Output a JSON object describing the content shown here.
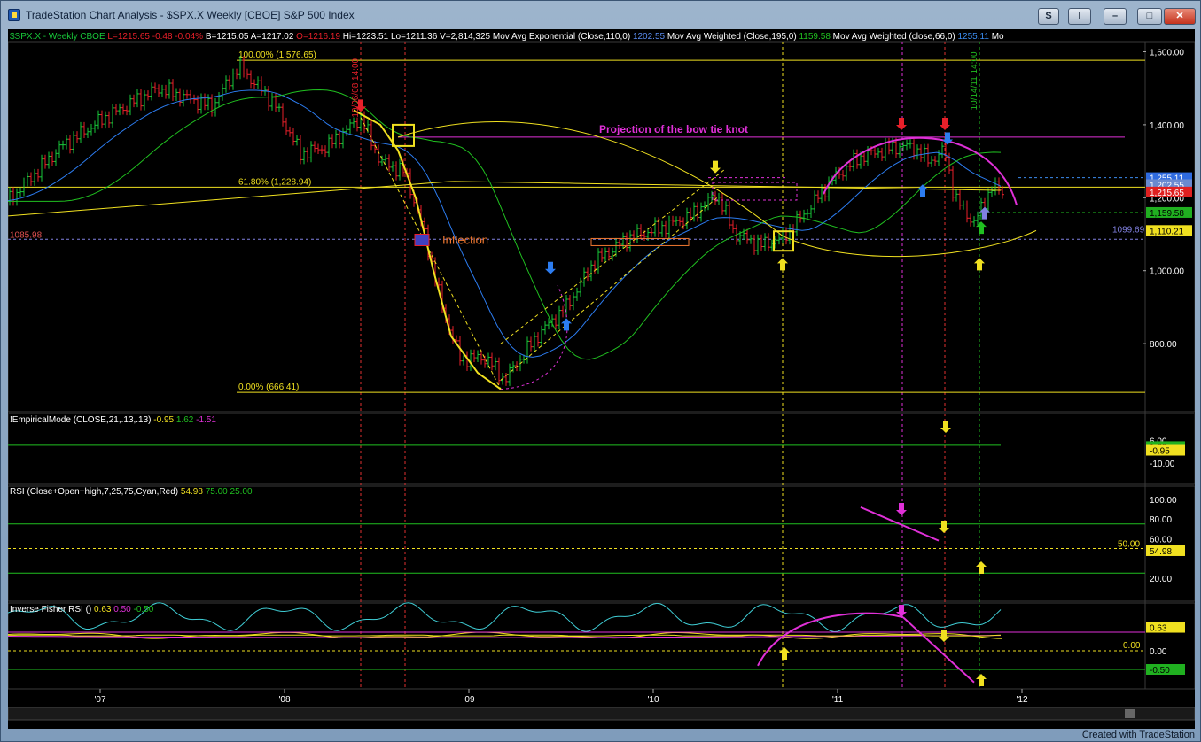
{
  "window": {
    "title": "TradeStation Chart Analysis - $SPX.X Weekly [CBOE] S&P 500 Index",
    "buttons": [
      "S",
      "I",
      "–",
      "□",
      "✕"
    ]
  },
  "header": {
    "symbol": "$SPX.X - Weekly  CBOE",
    "low": "L=1215.65",
    "change": "-0.48",
    "change_pct": "-0.04%",
    "bid": "B=1215.05",
    "ask": "A=1217.02",
    "open": "O=1216.19",
    "high": "Hi=1223.51",
    "lo": "Lo=1211.36",
    "volume": "V=2,814,325",
    "ema_label": "Mov Avg Exponential (Close,110,0)",
    "ema_value": "1202.55",
    "wma195_label": "Mov Avg Weighted (Close,195,0)",
    "wma195_value": "1159.58",
    "wma66_label": "Mov Avg Weighted (close,66,0)",
    "wma66_value": "1255.11",
    "more": "Mo"
  },
  "colors": {
    "background": "#000000",
    "price_up": "#18c83a",
    "price_down": "#e8202a",
    "fib": "#f0e020",
    "magenta": "#e030d8",
    "ema": "#2c7cf0",
    "wma195": "#20c020",
    "orange": "#f07830",
    "cyan": "#40d0d8"
  },
  "price_panel": {
    "y_ticks": [
      "1,600.00",
      "1,400.00",
      "1,200.00",
      "1,000.00",
      "800.00"
    ],
    "fib_100": "100.00% (1,576.65)",
    "fib_618": "61.80% (1,228.94)",
    "fib_0": "0.00% (666.41)",
    "left_level": "1085.98",
    "right_level": "1099.69",
    "date_label_1": "10/06/08 14:00",
    "date_label_2": "10/14/11 14:00",
    "annotation_bowtie": "Projection of the bow tie knot",
    "annotation_inflection": "Inflection",
    "badges": [
      {
        "text": "1,255.11",
        "bg": "#2f6be0",
        "fg": "#ffffff"
      },
      {
        "text": "1,202.55",
        "bg": "#6a8ad0",
        "fg": "#ffffff"
      },
      {
        "text": "1,215.65",
        "bg": "#e02020",
        "fg": "#ffffff"
      },
      {
        "text": "1,159.58",
        "bg": "#20b020",
        "fg": "#000000"
      },
      {
        "text": "1,110.21",
        "bg": "#f0e020",
        "fg": "#000000"
      }
    ]
  },
  "emd_panel": {
    "label": "!EmpiricalMode (CLOSE,21,.13,.13)",
    "v1": "-0.95",
    "v2": "1.62",
    "v3": "-1.51",
    "y_ticks": [
      "6.00",
      "-10.00"
    ],
    "badges": [
      {
        "text": "1.62",
        "bg": "#20b020",
        "fg": "#000000"
      },
      {
        "text": "-0.95",
        "bg": "#f0e020",
        "fg": "#000000"
      }
    ]
  },
  "rsi_panel": {
    "label": "RSI (Close+Open+high,7,25,75,Cyan,Red)",
    "v1": "54.98",
    "v2": "75.00",
    "v3": "25.00",
    "y_ticks": [
      "100.00",
      "80.00",
      "60.00",
      "20.00"
    ],
    "level_label": "50.00",
    "badges": [
      {
        "text": "54.98",
        "bg": "#f0e020",
        "fg": "#000000"
      }
    ]
  },
  "fisher_panel": {
    "label": "Inverse Fisher RSI ()",
    "v1": "0.63",
    "v2": "0.50",
    "v3": "-0.50",
    "y_ticks": [
      "0.00"
    ],
    "level_label": "0.00",
    "badges": [
      {
        "text": "0.63",
        "bg": "#f0e020",
        "fg": "#000000"
      },
      {
        "text": "-0.50",
        "bg": "#20b020",
        "fg": "#000000"
      }
    ]
  },
  "x_axis": {
    "labels": [
      "'07",
      "'08",
      "'09",
      "'10",
      "'11",
      "'12"
    ]
  },
  "footer": "Created with TradeStation"
}
